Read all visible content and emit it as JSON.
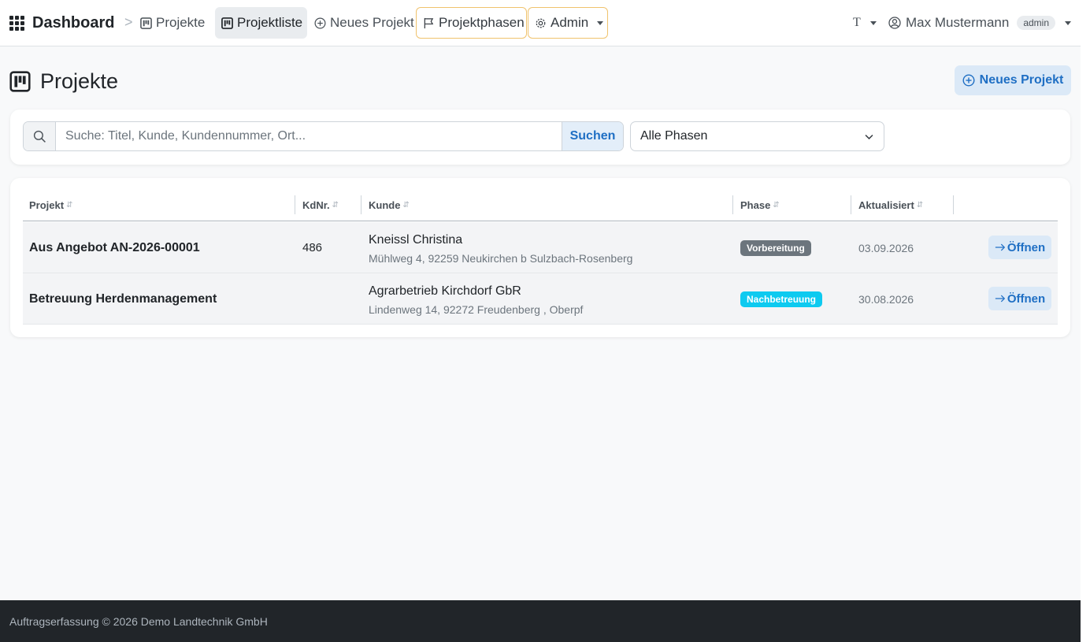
{
  "navbar": {
    "brand": "Dashboard",
    "crumb_separator": ">",
    "items": [
      {
        "label": "Projekte"
      },
      {
        "label": "Projektliste"
      },
      {
        "label": "Neues Projekt"
      },
      {
        "label": "Projektphasen"
      },
      {
        "label": "Admin"
      }
    ],
    "font_toggle": "T",
    "user_name": "Max Mustermann",
    "user_role": "admin"
  },
  "header": {
    "title": "Projekte",
    "new_project_label": "Neues Projekt"
  },
  "search": {
    "placeholder": "Suche: Titel, Kunde, Kundennummer, Ort...",
    "value": "",
    "button_label": "Suchen",
    "phase_filter_selected": "Alle Phasen"
  },
  "table": {
    "columns": [
      "Projekt",
      "KdNr.",
      "Kunde",
      "Phase",
      "Aktualisiert"
    ],
    "open_label": "Öffnen",
    "rows": [
      {
        "title": "Aus Angebot AN-2026-00001",
        "kdnr": "486",
        "customer_name": "Kneissl Christina",
        "customer_address": "Mühlweg 4, 92259 Neukirchen b Sulzbach-Rosenberg",
        "phase": "Vorbereitung",
        "phase_color": "#6c757d",
        "updated": "03.09.2026"
      },
      {
        "title": "Betreuung Herdenmanagement",
        "kdnr": "",
        "customer_name": "Agrarbetrieb Kirchdorf GbR",
        "customer_address": "Lindenweg 14, 92272 Freudenberg , Oberpf",
        "phase": "Nachbetreuung",
        "phase_color": "#0dcaf0",
        "updated": "30.08.2026"
      }
    ]
  },
  "footer": {
    "text": "Auftragserfassung © 2026 Demo Landtechnik GmbH"
  },
  "colors": {
    "primary": "#1f6fc4",
    "outline_accent": "#f0c36d",
    "footer_bg": "#212529"
  }
}
